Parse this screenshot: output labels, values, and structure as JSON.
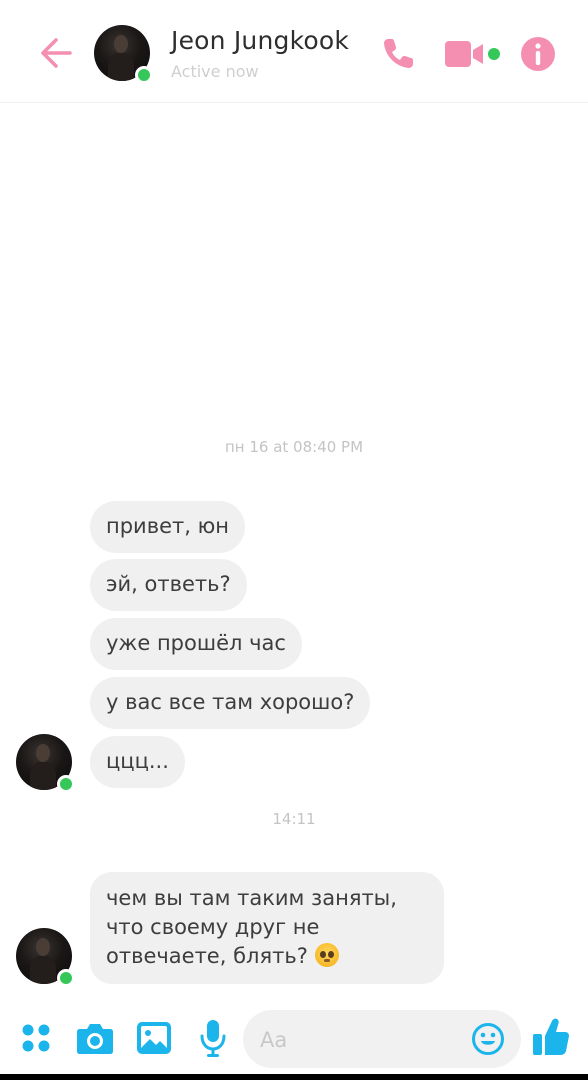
{
  "header": {
    "contact_name": "Jeon Jungkook",
    "status": "Active now",
    "accent_color": "#f48fb1",
    "online_color": "#35c759",
    "icons": [
      "back-arrow-icon",
      "phone-icon",
      "video-camera-icon",
      "info-icon"
    ]
  },
  "chat": {
    "timestamp_1": "пн 16 at 08:40 PM",
    "messages_group_1": [
      "привет, юн",
      "эй, ответь?",
      "уже прошёл час",
      "у вас все там хорошо?",
      "ццц..."
    ],
    "timestamp_2": "14:11",
    "message_group_2": {
      "text": "чем вы там таким заняты, что своему друг не отвечаете, блять?",
      "emoji": "pleading-face-emoji"
    }
  },
  "composer": {
    "placeholder": "Aa",
    "accent_color": "#1bb5ec",
    "icons": [
      "menu-dots-icon",
      "camera-icon",
      "gallery-icon",
      "microphone-icon",
      "emoji-icon",
      "thumbs-up-icon"
    ]
  }
}
